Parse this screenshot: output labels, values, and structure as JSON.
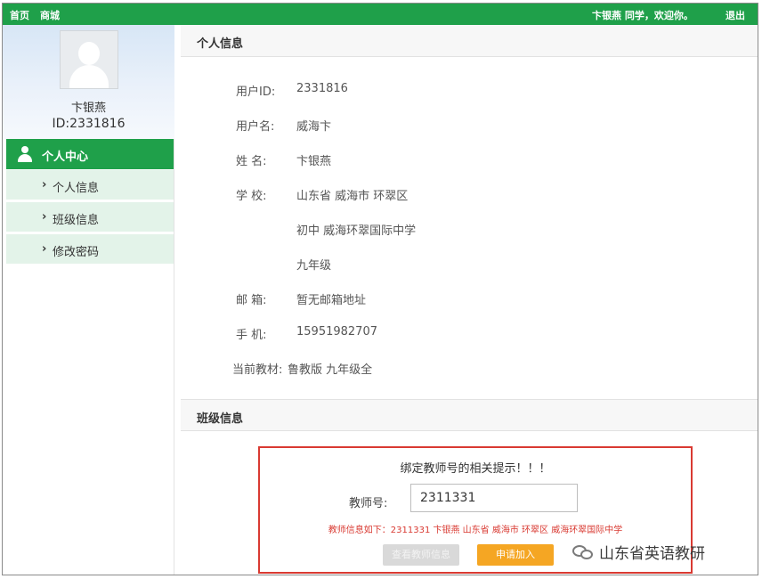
{
  "topbar": {
    "nav": [
      "首页",
      "商城"
    ],
    "greeting": "卞银燕 同学，欢迎你。",
    "logout": "退出"
  },
  "profile": {
    "name": "卞银燕",
    "id_text": "ID:2331816"
  },
  "sidebar": {
    "header": "个人中心",
    "items": [
      "个人信息",
      "班级信息",
      "修改密码"
    ],
    "accent_color": "#1fa04a",
    "item_bg": "#e3f3e9"
  },
  "personal_info": {
    "heading": "个人信息",
    "fields": [
      {
        "label": "用户ID:",
        "value": "2331816"
      },
      {
        "label": "用户名:",
        "value": "威海卞"
      },
      {
        "label": "姓    名:",
        "value": "卞银燕"
      },
      {
        "label": "学    校:",
        "value": "山东省   威海市   环翠区"
      },
      {
        "label": "",
        "value": "初中   威海环翠国际中学"
      },
      {
        "label": "",
        "value": "九年级"
      },
      {
        "label": "邮    箱:",
        "value": "暂无邮箱地址"
      },
      {
        "label": "手    机:",
        "value": "15951982707"
      },
      {
        "label": "当前教材:",
        "value": "鲁教版   九年级全"
      }
    ]
  },
  "class_info": {
    "heading": "班级信息",
    "notice": {
      "title": "绑定教师号的相关提示！！！",
      "teacher_label": "教师号:",
      "teacher_value": "2311331",
      "teacher_info": "教师信息如下：2311331 卞银燕 山东省 威海市 环翠区 威海环翠国际中学",
      "btn_secondary": "查看教师信息",
      "btn_primary": "申请加入",
      "border_color": "#d93a32"
    }
  },
  "watermark": "山东省英语教研"
}
